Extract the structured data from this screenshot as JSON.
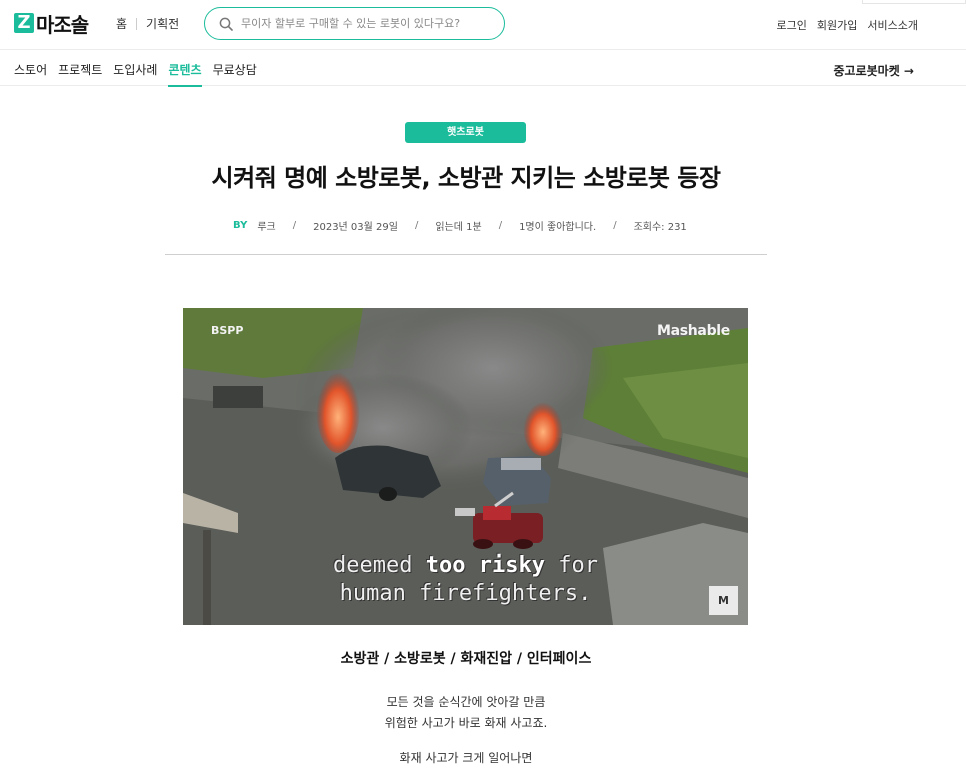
{
  "header": {
    "logo_text": "마조솔",
    "nav": [
      "홈",
      "기획전"
    ],
    "search_placeholder": "무이자 할부로 구매할 수 있는 로봇이 있다구요?",
    "auth": [
      "로그인",
      "회원가입",
      "서비스소개"
    ],
    "accent_color": "#1bbc9b"
  },
  "subnav": {
    "tabs": [
      "스토어",
      "프로젝트",
      "도입사례",
      "콘텐츠",
      "무료상담"
    ],
    "active_tab": "콘텐츠",
    "market_link": "중고로봇마켓 →"
  },
  "article": {
    "category": "햇츠로봇",
    "title": "시켜줘 명예 소방로봇, 소방관 지키는 소방로봇 등장",
    "meta": {
      "by_label": "BY",
      "author": "루크",
      "date": "2023년 03월 29일",
      "read_time": "읽는데 1분",
      "likes": "1명이 좋아합니다.",
      "views": "조회수: 231"
    },
    "video": {
      "source_label": "BSPP",
      "brand": "Mashable",
      "caption_line1_pre": "deemed ",
      "caption_line1_bold": "too risky",
      "caption_line1_post": " for",
      "caption_line2": "human firefighters.",
      "corner_badge": "M"
    },
    "tags": "소방관 / 소방로봇 / 화재진압 / 인터페이스",
    "paragraphs": [
      "모든 것을 순식간에 앗아갈 만큼",
      "위험한 사고가 바로 화재 사고죠.",
      "화재 사고가 크게 일어나면"
    ]
  }
}
